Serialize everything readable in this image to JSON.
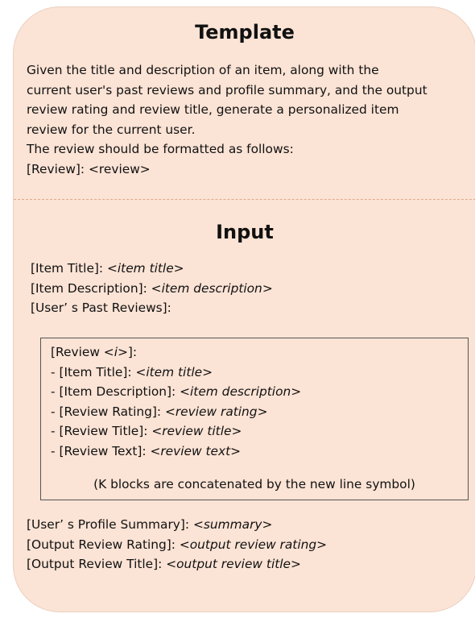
{
  "template": {
    "title": "Template",
    "lines": [
      "Given the title and description of an item, along with the",
      "current user's past reviews and profile summary, and the output",
      "review rating and review title, generate a personalized item",
      "review for the current user.",
      "The review should be formatted as follows:",
      "[Review]: <review>"
    ]
  },
  "input": {
    "title": "Input",
    "fields": [
      {
        "label": "[Item Title]: <",
        "placeholder": "item title",
        "suffix": ">"
      },
      {
        "label": "[Item Description]: <",
        "placeholder": "item description",
        "suffix": ">"
      },
      {
        "label": "[User’ s Past Reviews]:",
        "placeholder": "",
        "suffix": ""
      }
    ],
    "review_block": {
      "header": {
        "label": "[Review <",
        "placeholder": "i",
        "suffix": ">]:"
      },
      "fields": [
        {
          "label": "- [Item Title]: <",
          "placeholder": "item title",
          "suffix": ">"
        },
        {
          "label": "- [Item Description]: <",
          "placeholder": "item description",
          "suffix": ">"
        },
        {
          "label": "- [Review Rating]: <",
          "placeholder": "review rating",
          "suffix": ">"
        },
        {
          "label": "- [Review Title]: <",
          "placeholder": "review title",
          "suffix": ">"
        },
        {
          "label": "- [Review Text]: <",
          "placeholder": "review text",
          "suffix": ">"
        }
      ],
      "note": "(K blocks are concatenated by the new line symbol)"
    },
    "bottom_fields": [
      {
        "label": "[User’ s Profile Summary]: <",
        "placeholder": "summary",
        "suffix": ">"
      },
      {
        "label": "[Output Review Rating]: <",
        "placeholder": "output review rating",
        "suffix": ">"
      },
      {
        "label": "[Output Review Title]: <",
        "placeholder": "output review title",
        "suffix": ">"
      }
    ]
  },
  "colors": {
    "card_background": "#fbe3d5",
    "divider": "#e0a98a",
    "box_border": "#555555"
  }
}
